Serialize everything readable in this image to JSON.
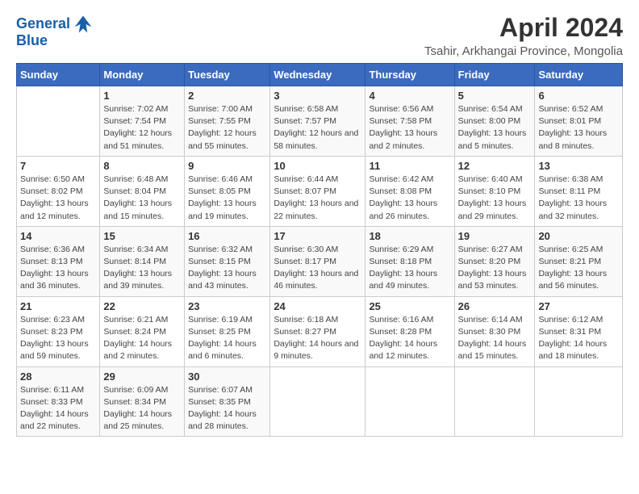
{
  "header": {
    "logo_line1": "General",
    "logo_line2": "Blue",
    "title": "April 2024",
    "subtitle": "Tsahir, Arkhangai Province, Mongolia"
  },
  "calendar": {
    "days_of_week": [
      "Sunday",
      "Monday",
      "Tuesday",
      "Wednesday",
      "Thursday",
      "Friday",
      "Saturday"
    ],
    "weeks": [
      [
        {
          "day": "",
          "sunrise": "",
          "sunset": "",
          "daylight": ""
        },
        {
          "day": "1",
          "sunrise": "Sunrise: 7:02 AM",
          "sunset": "Sunset: 7:54 PM",
          "daylight": "Daylight: 12 hours and 51 minutes."
        },
        {
          "day": "2",
          "sunrise": "Sunrise: 7:00 AM",
          "sunset": "Sunset: 7:55 PM",
          "daylight": "Daylight: 12 hours and 55 minutes."
        },
        {
          "day": "3",
          "sunrise": "Sunrise: 6:58 AM",
          "sunset": "Sunset: 7:57 PM",
          "daylight": "Daylight: 12 hours and 58 minutes."
        },
        {
          "day": "4",
          "sunrise": "Sunrise: 6:56 AM",
          "sunset": "Sunset: 7:58 PM",
          "daylight": "Daylight: 13 hours and 2 minutes."
        },
        {
          "day": "5",
          "sunrise": "Sunrise: 6:54 AM",
          "sunset": "Sunset: 8:00 PM",
          "daylight": "Daylight: 13 hours and 5 minutes."
        },
        {
          "day": "6",
          "sunrise": "Sunrise: 6:52 AM",
          "sunset": "Sunset: 8:01 PM",
          "daylight": "Daylight: 13 hours and 8 minutes."
        }
      ],
      [
        {
          "day": "7",
          "sunrise": "Sunrise: 6:50 AM",
          "sunset": "Sunset: 8:02 PM",
          "daylight": "Daylight: 13 hours and 12 minutes."
        },
        {
          "day": "8",
          "sunrise": "Sunrise: 6:48 AM",
          "sunset": "Sunset: 8:04 PM",
          "daylight": "Daylight: 13 hours and 15 minutes."
        },
        {
          "day": "9",
          "sunrise": "Sunrise: 6:46 AM",
          "sunset": "Sunset: 8:05 PM",
          "daylight": "Daylight: 13 hours and 19 minutes."
        },
        {
          "day": "10",
          "sunrise": "Sunrise: 6:44 AM",
          "sunset": "Sunset: 8:07 PM",
          "daylight": "Daylight: 13 hours and 22 minutes."
        },
        {
          "day": "11",
          "sunrise": "Sunrise: 6:42 AM",
          "sunset": "Sunset: 8:08 PM",
          "daylight": "Daylight: 13 hours and 26 minutes."
        },
        {
          "day": "12",
          "sunrise": "Sunrise: 6:40 AM",
          "sunset": "Sunset: 8:10 PM",
          "daylight": "Daylight: 13 hours and 29 minutes."
        },
        {
          "day": "13",
          "sunrise": "Sunrise: 6:38 AM",
          "sunset": "Sunset: 8:11 PM",
          "daylight": "Daylight: 13 hours and 32 minutes."
        }
      ],
      [
        {
          "day": "14",
          "sunrise": "Sunrise: 6:36 AM",
          "sunset": "Sunset: 8:13 PM",
          "daylight": "Daylight: 13 hours and 36 minutes."
        },
        {
          "day": "15",
          "sunrise": "Sunrise: 6:34 AM",
          "sunset": "Sunset: 8:14 PM",
          "daylight": "Daylight: 13 hours and 39 minutes."
        },
        {
          "day": "16",
          "sunrise": "Sunrise: 6:32 AM",
          "sunset": "Sunset: 8:15 PM",
          "daylight": "Daylight: 13 hours and 43 minutes."
        },
        {
          "day": "17",
          "sunrise": "Sunrise: 6:30 AM",
          "sunset": "Sunset: 8:17 PM",
          "daylight": "Daylight: 13 hours and 46 minutes."
        },
        {
          "day": "18",
          "sunrise": "Sunrise: 6:29 AM",
          "sunset": "Sunset: 8:18 PM",
          "daylight": "Daylight: 13 hours and 49 minutes."
        },
        {
          "day": "19",
          "sunrise": "Sunrise: 6:27 AM",
          "sunset": "Sunset: 8:20 PM",
          "daylight": "Daylight: 13 hours and 53 minutes."
        },
        {
          "day": "20",
          "sunrise": "Sunrise: 6:25 AM",
          "sunset": "Sunset: 8:21 PM",
          "daylight": "Daylight: 13 hours and 56 minutes."
        }
      ],
      [
        {
          "day": "21",
          "sunrise": "Sunrise: 6:23 AM",
          "sunset": "Sunset: 8:23 PM",
          "daylight": "Daylight: 13 hours and 59 minutes."
        },
        {
          "day": "22",
          "sunrise": "Sunrise: 6:21 AM",
          "sunset": "Sunset: 8:24 PM",
          "daylight": "Daylight: 14 hours and 2 minutes."
        },
        {
          "day": "23",
          "sunrise": "Sunrise: 6:19 AM",
          "sunset": "Sunset: 8:25 PM",
          "daylight": "Daylight: 14 hours and 6 minutes."
        },
        {
          "day": "24",
          "sunrise": "Sunrise: 6:18 AM",
          "sunset": "Sunset: 8:27 PM",
          "daylight": "Daylight: 14 hours and 9 minutes."
        },
        {
          "day": "25",
          "sunrise": "Sunrise: 6:16 AM",
          "sunset": "Sunset: 8:28 PM",
          "daylight": "Daylight: 14 hours and 12 minutes."
        },
        {
          "day": "26",
          "sunrise": "Sunrise: 6:14 AM",
          "sunset": "Sunset: 8:30 PM",
          "daylight": "Daylight: 14 hours and 15 minutes."
        },
        {
          "day": "27",
          "sunrise": "Sunrise: 6:12 AM",
          "sunset": "Sunset: 8:31 PM",
          "daylight": "Daylight: 14 hours and 18 minutes."
        }
      ],
      [
        {
          "day": "28",
          "sunrise": "Sunrise: 6:11 AM",
          "sunset": "Sunset: 8:33 PM",
          "daylight": "Daylight: 14 hours and 22 minutes."
        },
        {
          "day": "29",
          "sunrise": "Sunrise: 6:09 AM",
          "sunset": "Sunset: 8:34 PM",
          "daylight": "Daylight: 14 hours and 25 minutes."
        },
        {
          "day": "30",
          "sunrise": "Sunrise: 6:07 AM",
          "sunset": "Sunset: 8:35 PM",
          "daylight": "Daylight: 14 hours and 28 minutes."
        },
        {
          "day": "",
          "sunrise": "",
          "sunset": "",
          "daylight": ""
        },
        {
          "day": "",
          "sunrise": "",
          "sunset": "",
          "daylight": ""
        },
        {
          "day": "",
          "sunrise": "",
          "sunset": "",
          "daylight": ""
        },
        {
          "day": "",
          "sunrise": "",
          "sunset": "",
          "daylight": ""
        }
      ]
    ]
  }
}
